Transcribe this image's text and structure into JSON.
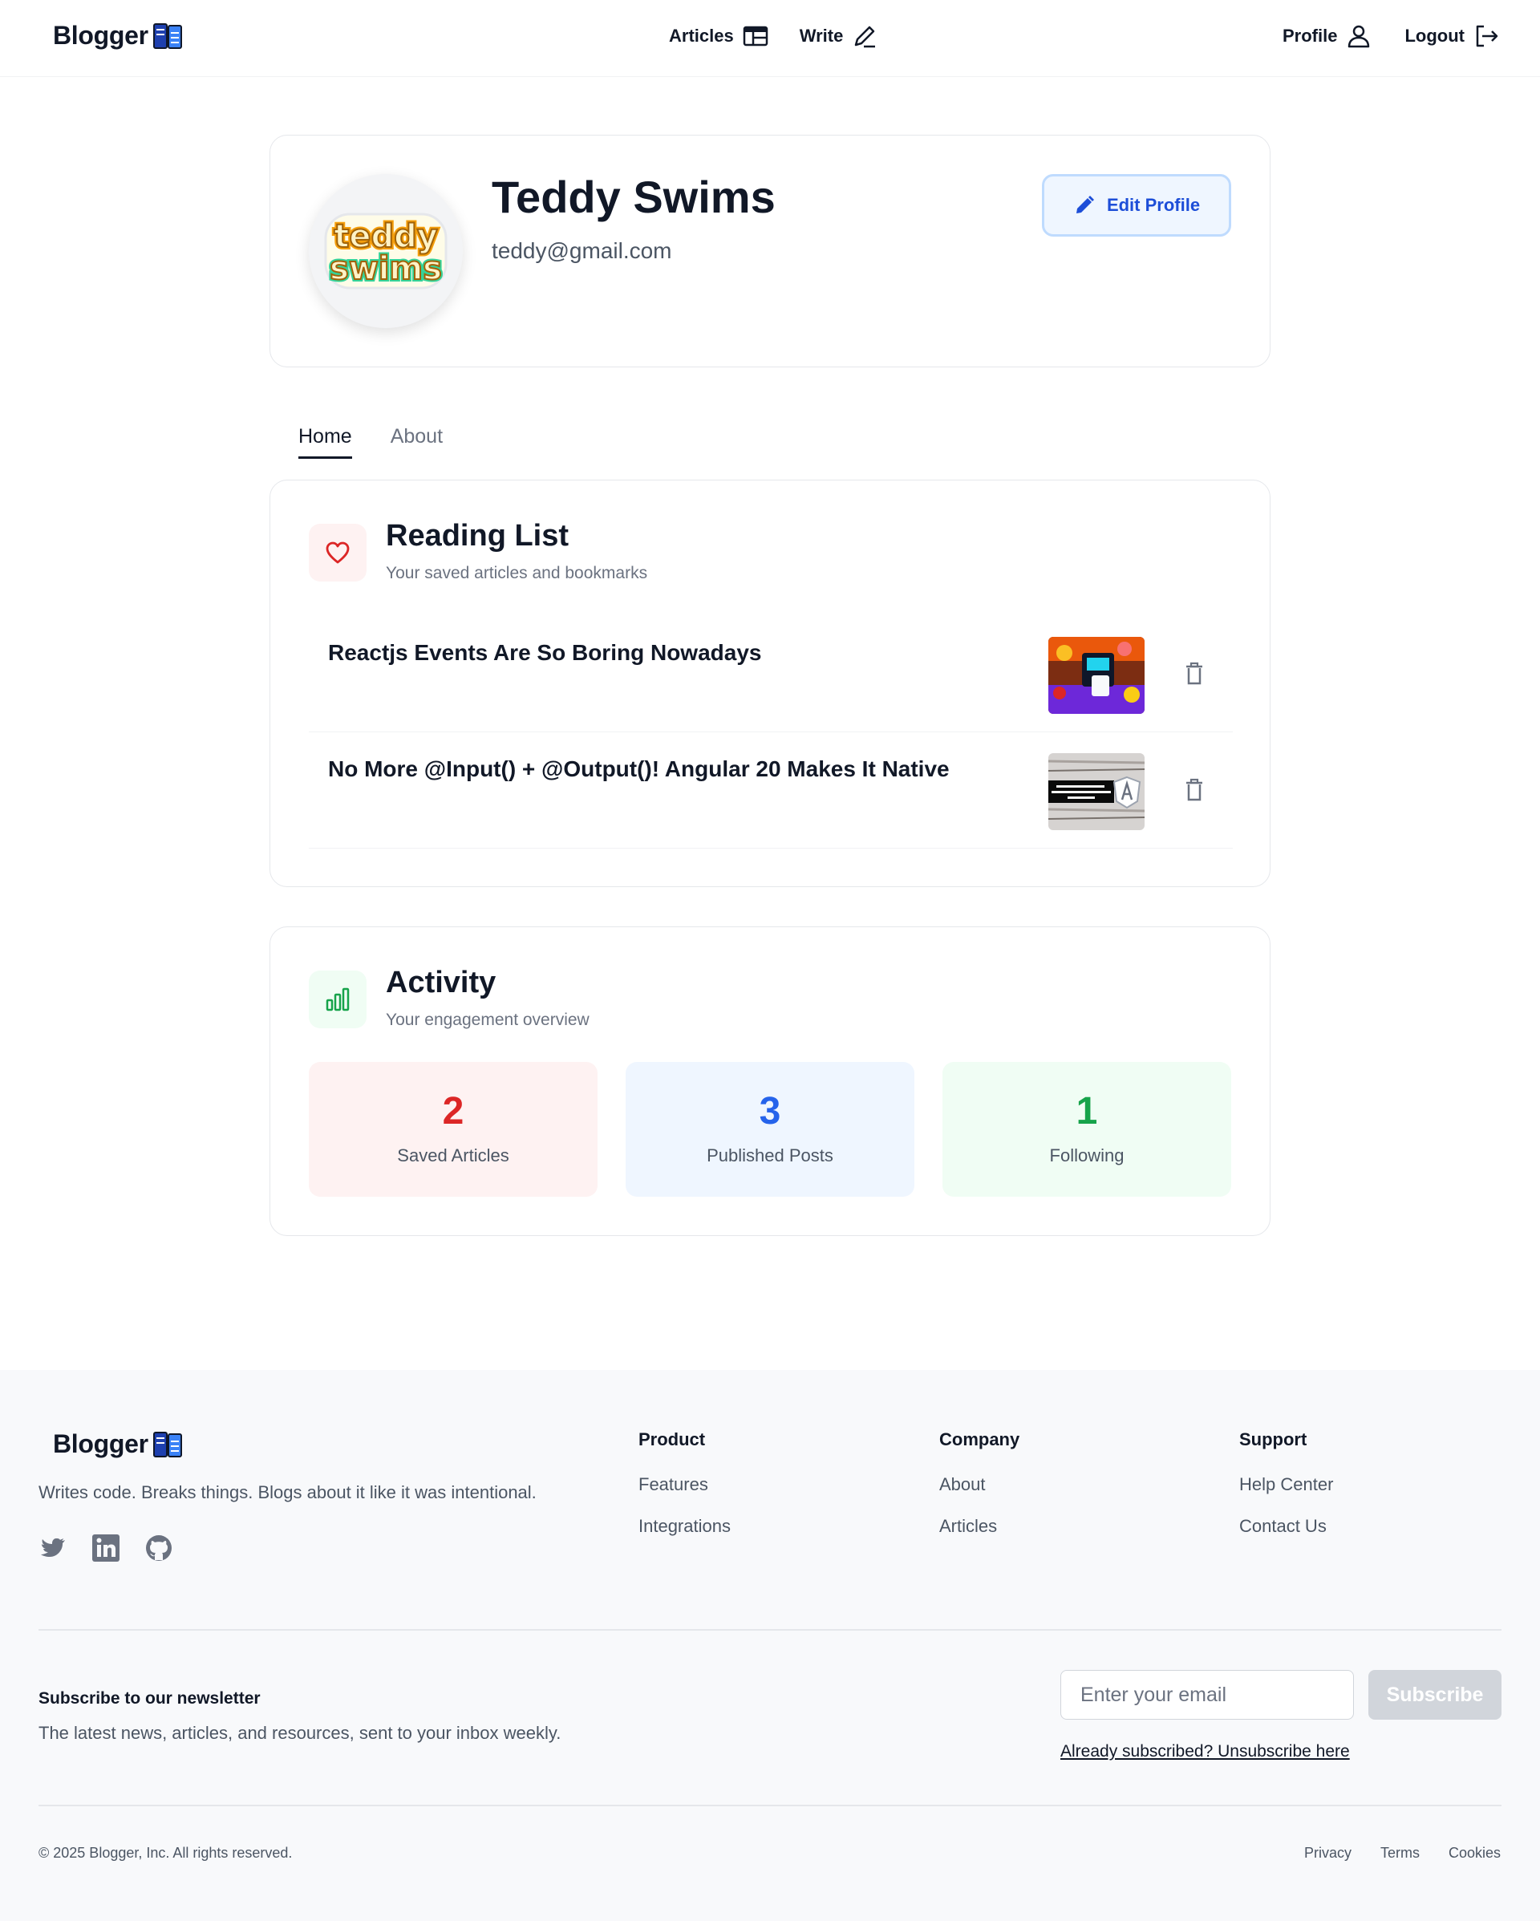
{
  "header": {
    "logo_text": "Blogger",
    "nav": {
      "articles": "Articles",
      "write": "Write",
      "profile": "Profile",
      "logout": "Logout"
    }
  },
  "profile": {
    "name": "Teddy Swims",
    "email": "teddy@gmail.com",
    "avatar_text": "teddy swims",
    "edit_label": "Edit Profile"
  },
  "tabs": [
    {
      "label": "Home",
      "active": true
    },
    {
      "label": "About",
      "active": false
    }
  ],
  "reading_list": {
    "title": "Reading List",
    "subtitle": "Your saved articles and bookmarks",
    "items": [
      {
        "title": "Reactjs Events Are So Boring Nowadays"
      },
      {
        "title": "No More @Input() + @Output()! Angular 20 Makes It Native"
      }
    ]
  },
  "activity": {
    "title": "Activity",
    "subtitle": "Your engagement overview",
    "stats": [
      {
        "value": "2",
        "label": "Saved Articles",
        "color": "#dc2626",
        "bg": "#fef2f2"
      },
      {
        "value": "3",
        "label": "Published Posts",
        "color": "#2563eb",
        "bg": "#eff6ff"
      },
      {
        "value": "1",
        "label": "Following",
        "color": "#16a34a",
        "bg": "#f0fdf4"
      }
    ]
  },
  "footer": {
    "logo_text": "Blogger",
    "tagline": "Writes code. Breaks things. Blogs about it like it was intentional.",
    "columns": [
      {
        "title": "Product",
        "links": [
          "Features",
          "Integrations"
        ]
      },
      {
        "title": "Company",
        "links": [
          "About",
          "Articles"
        ]
      },
      {
        "title": "Support",
        "links": [
          "Help Center",
          "Contact Us"
        ]
      }
    ],
    "newsletter": {
      "title": "Subscribe to our newsletter",
      "subtitle": "The latest news, articles, and resources, sent to your inbox weekly.",
      "placeholder": "Enter your email",
      "button": "Subscribe",
      "unsubscribe": "Already subscribed? Unsubscribe here"
    },
    "copyright": "© 2025 Blogger, Inc. All rights reserved.",
    "legal": [
      "Privacy",
      "Terms",
      "Cookies"
    ]
  }
}
